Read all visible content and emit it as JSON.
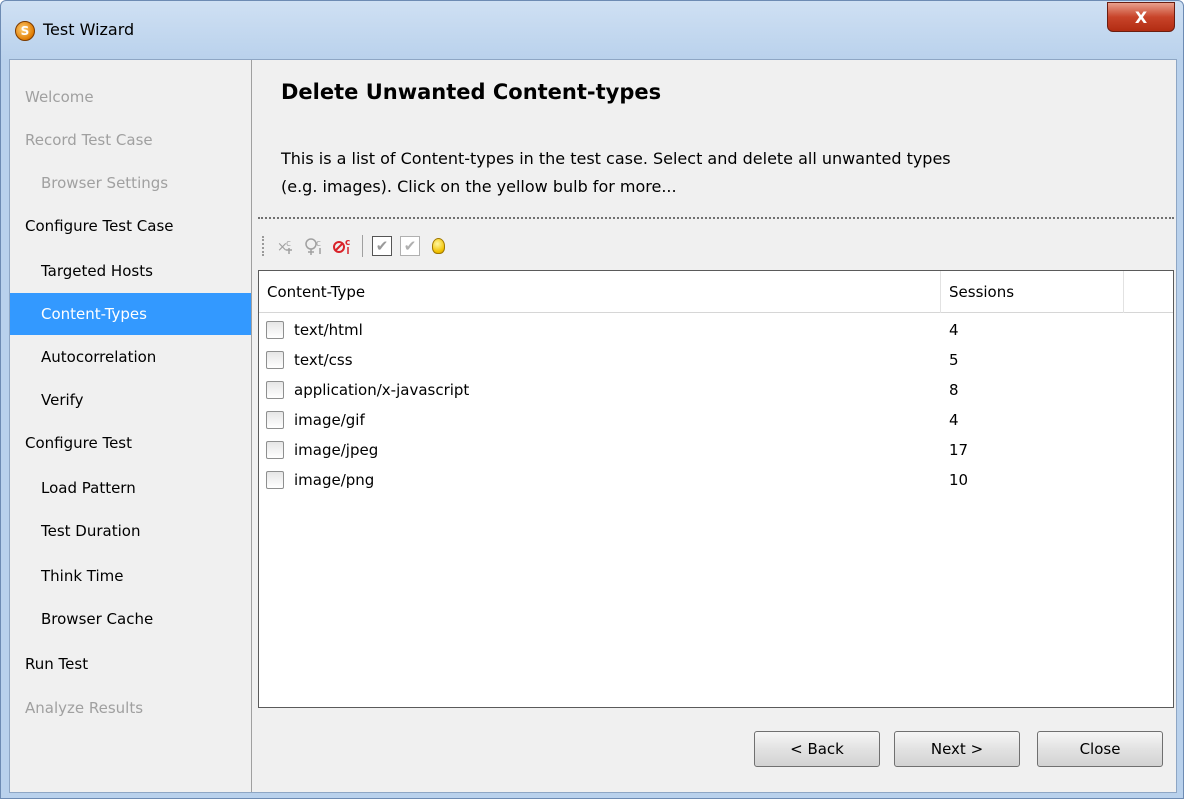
{
  "window": {
    "title": "Test Wizard",
    "app_icon_glyph": "S",
    "close_glyph": "X"
  },
  "sidebar": {
    "items": [
      {
        "label": "Welcome",
        "level": 0,
        "state": "disabled"
      },
      {
        "label": "Record Test Case",
        "level": 0,
        "state": "disabled"
      },
      {
        "label": "Browser Settings",
        "level": 1,
        "state": "disabled"
      },
      {
        "label": "Configure Test Case",
        "level": 0,
        "state": "normal"
      },
      {
        "label": "Targeted Hosts",
        "level": 1,
        "state": "normal"
      },
      {
        "label": "Content-Types",
        "level": 1,
        "state": "selected"
      },
      {
        "label": "Autocorrelation",
        "level": 1,
        "state": "normal"
      },
      {
        "label": "Verify",
        "level": 1,
        "state": "normal"
      },
      {
        "label": "Configure Test",
        "level": 0,
        "state": "normal"
      },
      {
        "label": "Load Pattern",
        "level": 1,
        "state": "normal"
      },
      {
        "label": "Test Duration",
        "level": 1,
        "state": "normal"
      },
      {
        "label": "Think Time",
        "level": 1,
        "state": "normal"
      },
      {
        "label": "Browser Cache",
        "level": 1,
        "state": "normal"
      },
      {
        "label": "Run Test",
        "level": 0,
        "state": "normal"
      },
      {
        "label": "Analyze Results",
        "level": 0,
        "state": "disabled"
      }
    ]
  },
  "main": {
    "title": "Delete Unwanted Content-types",
    "description_line1": "This is a list of Content-types in the test case. Select and delete all unwanted types",
    "description_line2": "(e.g. images). Click on the yellow bulb for more...",
    "toolbar": {
      "icons": [
        "delete-content-type-icon",
        "add-content-type-icon",
        "remove-content-type-icon",
        "check-all-icon",
        "uncheck-all-icon",
        "help-bulb-icon"
      ]
    },
    "table": {
      "headers": [
        "Content-Type",
        "Sessions",
        ""
      ],
      "rows": [
        {
          "type": "text/html",
          "sessions": "4",
          "checked": false
        },
        {
          "type": "text/css",
          "sessions": "5",
          "checked": false
        },
        {
          "type": "application/x-javascript",
          "sessions": "8",
          "checked": false
        },
        {
          "type": "image/gif",
          "sessions": "4",
          "checked": false
        },
        {
          "type": "image/jpeg",
          "sessions": "17",
          "checked": false
        },
        {
          "type": "image/png",
          "sessions": "10",
          "checked": false
        }
      ]
    }
  },
  "buttons": {
    "back": "< Back",
    "next": "Next >",
    "close": "Close"
  },
  "colors": {
    "selection": "#3399ff",
    "disabled_text": "#a0a0a0",
    "close_button": "#c8442a"
  }
}
